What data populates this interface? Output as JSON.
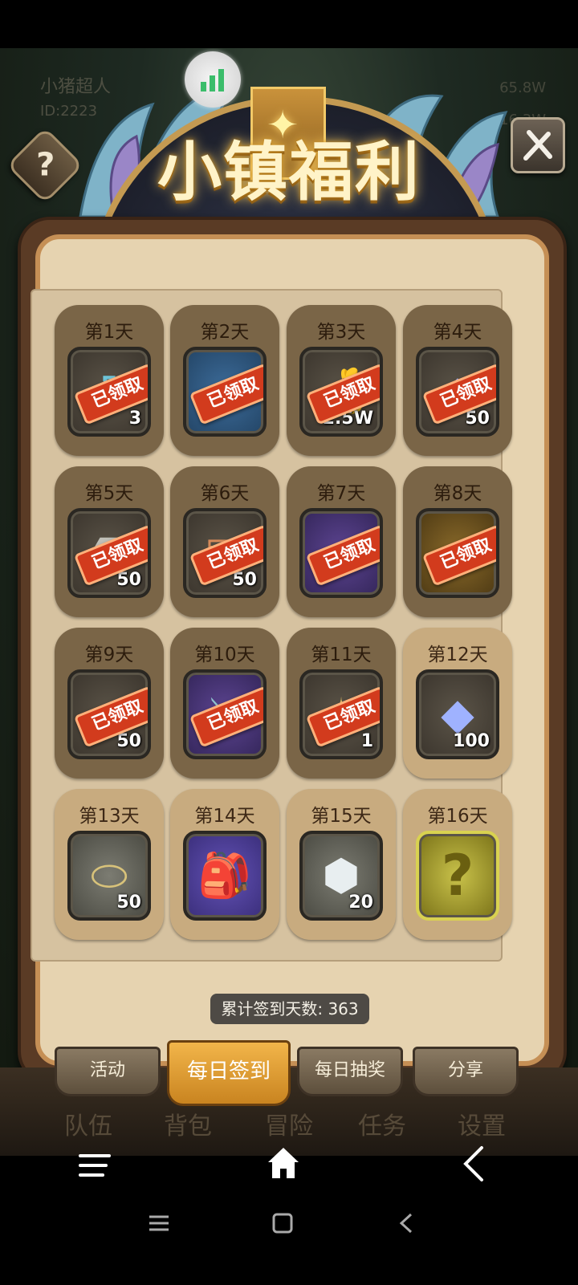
{
  "background_hud": {
    "player_name": "小猪超人",
    "player_id": "ID:2223",
    "right_top": "65.8W",
    "right_bottom": "16.3W"
  },
  "header": {
    "title": "小镇福利",
    "help_icon": "question-icon",
    "settings_icon": "tools-icon"
  },
  "status": {
    "signal_icon": "signal-bars-icon"
  },
  "stamp_label": "已领取",
  "days": [
    {
      "label": "第1天",
      "item": "potion",
      "qty": "3",
      "claimed": true
    },
    {
      "label": "第2天",
      "item": "mystery-box-blue",
      "qty": "",
      "claimed": true
    },
    {
      "label": "第3天",
      "item": "gold-bag",
      "qty": "2.5W",
      "claimed": true
    },
    {
      "label": "第4天",
      "item": "blue-gem",
      "qty": "50",
      "claimed": true
    },
    {
      "label": "第5天",
      "item": "ore",
      "qty": "50",
      "claimed": true
    },
    {
      "label": "第6天",
      "item": "scroll",
      "qty": "50",
      "claimed": true
    },
    {
      "label": "第7天",
      "item": "mystery-box-purple",
      "qty": "",
      "claimed": true
    },
    {
      "label": "第8天",
      "item": "mystery-box-gold",
      "qty": "",
      "claimed": true
    },
    {
      "label": "第9天",
      "item": "iron-ingot",
      "qty": "50",
      "claimed": true
    },
    {
      "label": "第10天",
      "item": "sword",
      "qty": "",
      "claimed": true
    },
    {
      "label": "第11天",
      "item": "magic-sparkle",
      "qty": "1",
      "claimed": true
    },
    {
      "label": "第12天",
      "item": "blue-gem",
      "qty": "100",
      "claimed": false
    },
    {
      "label": "第13天",
      "item": "wood-log",
      "qty": "50",
      "claimed": false
    },
    {
      "label": "第14天",
      "item": "backpack",
      "qty": "",
      "claimed": false
    },
    {
      "label": "第15天",
      "item": "rune-stone",
      "qty": "20",
      "claimed": false
    },
    {
      "label": "第16天",
      "item": "mystery-question",
      "qty": "",
      "claimed": false
    }
  ],
  "total_signin": "累计签到天数: 363",
  "tabs": [
    {
      "label": "活动",
      "active": false
    },
    {
      "label": "每日签到",
      "active": true
    },
    {
      "label": "每日抽奖",
      "active": false
    },
    {
      "label": "分享",
      "active": false
    }
  ],
  "bottom_nav": [
    "队伍",
    "背包",
    "冒险",
    "任务",
    "设置"
  ],
  "system_nav": {
    "menu_icon": "menu-icon",
    "home_icon": "home-icon",
    "back_icon": "back-icon"
  }
}
